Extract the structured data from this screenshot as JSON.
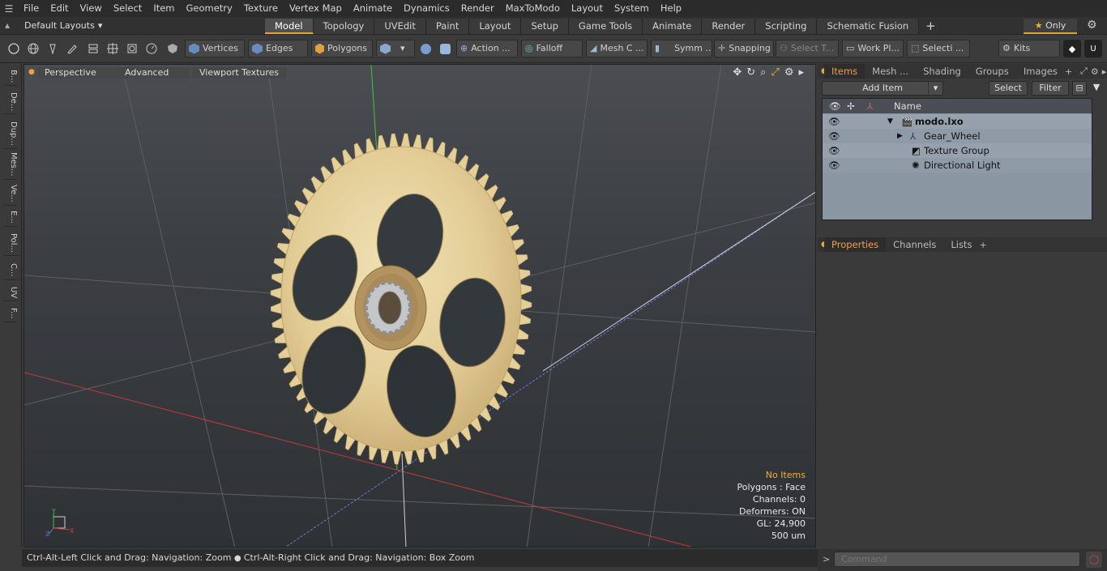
{
  "menu": [
    "File",
    "Edit",
    "View",
    "Select",
    "Item",
    "Geometry",
    "Texture",
    "Vertex Map",
    "Animate",
    "Dynamics",
    "Render",
    "MaxToModo",
    "Layout",
    "System",
    "Help"
  ],
  "layouts_label": "Default Layouts",
  "mode_tabs": [
    {
      "label": "Model",
      "active": true
    },
    {
      "label": "Topology"
    },
    {
      "label": "UVEdit"
    },
    {
      "label": "Paint"
    },
    {
      "label": "Layout"
    },
    {
      "label": "Setup"
    },
    {
      "label": "Game Tools"
    },
    {
      "label": "Animate"
    },
    {
      "label": "Render"
    },
    {
      "label": "Scripting"
    },
    {
      "label": "Schematic Fusion"
    }
  ],
  "only_label": "Only",
  "toolbar": {
    "vertices": "Vertices",
    "edges": "Edges",
    "polygons": "Polygons",
    "action": "Action ...",
    "falloff": "Falloff",
    "meshc": "Mesh C ...",
    "symm": "Symm ...",
    "snapping": "Snapping",
    "selectt": "Select T...",
    "workpl": "Work Pl...",
    "selecti": "Selecti ...",
    "kits": "Kits"
  },
  "left_tabs": [
    "B...",
    "De...",
    "Dup...",
    "Mes...",
    "Ve...",
    "E...",
    "Pol...",
    "C...",
    "UV",
    "F..."
  ],
  "viewport": {
    "perspective": "Perspective",
    "advanced": "Advanced",
    "textures": "Viewport Textures"
  },
  "info": {
    "items": "No Items",
    "polygons": "Polygons : Face",
    "channels": "Channels: 0",
    "deformers": "Deformers: ON",
    "gl": "GL: 24,900",
    "units": "500 um"
  },
  "status": {
    "left": "Ctrl-Alt-Left Click and Drag: Navigation: Zoom",
    "right": "Ctrl-Alt-Right Click and Drag: Navigation: Box Zoom"
  },
  "right_tabs": [
    "Items",
    "Mesh ...",
    "Shading",
    "Groups",
    "Images"
  ],
  "add_item": "Add Item",
  "select_btn": "Select",
  "filter_btn": "Filter",
  "col_name": "Name",
  "tree": [
    "modo.lxo",
    "Gear_Wheel",
    "Texture Group",
    "Directional Light"
  ],
  "prop_tabs": [
    "Properties",
    "Channels",
    "Lists"
  ],
  "command_placeholder": "Command"
}
